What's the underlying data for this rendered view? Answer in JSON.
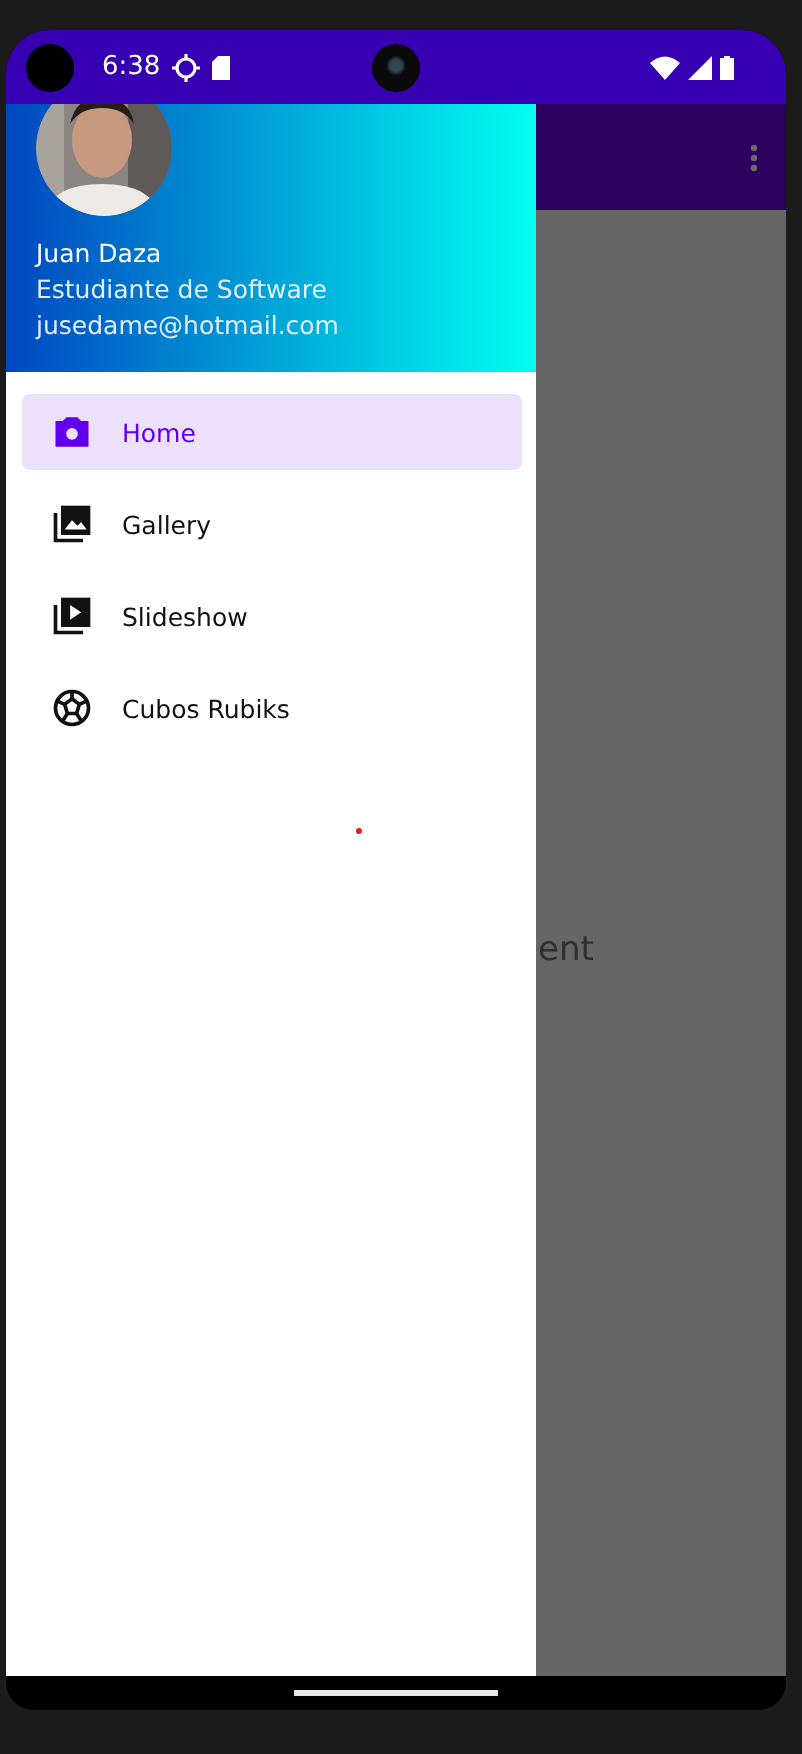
{
  "status_bar": {
    "time": "6:38"
  },
  "drawer": {
    "header": {
      "name": "Juan Daza",
      "subtitle": "Estudiante de Software",
      "email": "jusedame@hotmail.com"
    },
    "items": [
      {
        "label": "Home",
        "selected": true
      },
      {
        "label": "Gallery",
        "selected": false
      },
      {
        "label": "Slideshow",
        "selected": false
      },
      {
        "label": "Cubos Rubiks",
        "selected": false
      }
    ]
  },
  "content": {
    "text": "ent"
  }
}
